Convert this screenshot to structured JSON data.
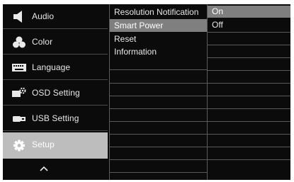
{
  "menu": {
    "items": [
      {
        "label": "Audio",
        "icon": "speaker-icon"
      },
      {
        "label": "Color",
        "icon": "color-circles-icon"
      },
      {
        "label": "Language",
        "icon": "keyboard-icon"
      },
      {
        "label": "OSD Setting",
        "icon": "display-gear-icon"
      },
      {
        "label": "USB Setting",
        "icon": "usb-plug-icon"
      },
      {
        "label": "Setup",
        "icon": "gear-icon",
        "selected": true
      }
    ],
    "scroll_up_icon": "chevron-up-icon"
  },
  "submenu": {
    "items": [
      {
        "label": "Resolution Notification"
      },
      {
        "label": "Smart Power",
        "selected": true
      },
      {
        "label": "Reset"
      },
      {
        "label": "Information"
      }
    ]
  },
  "options": {
    "items": [
      {
        "label": "On"
      },
      {
        "label": "Off",
        "selected": true
      }
    ]
  },
  "colors": {
    "background": "#0b0b0b",
    "text": "#e8e8e8",
    "selected_menu": "#bdbdbd",
    "highlight": "#7f7f7f",
    "divider": "#5a5a5a"
  }
}
